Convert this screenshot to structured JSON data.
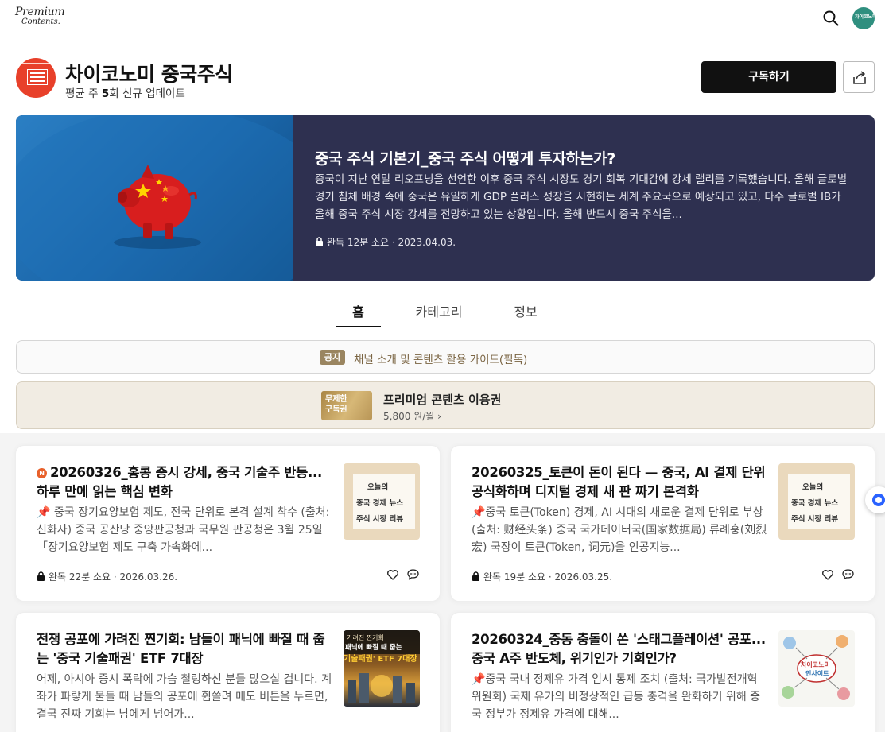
{
  "header": {
    "logo_line1": "Premium",
    "logo_line2": "Contents.",
    "search_icon": "search-icon",
    "avatar_text": "차이코노미"
  },
  "channel": {
    "title": "차이코노미 중국주식",
    "subtitle_prefix": "평균 주 ",
    "subtitle_count": "5",
    "subtitle_suffix": "회 신규 업데이트",
    "subscribe_label": "구독하기",
    "share_icon": "share-icon"
  },
  "hero": {
    "title": "중국 주식 기본기_중국 주식 어떻게 투자하는가?",
    "description": "중국이 지난 연말 리오프닝을 선언한 이후 중국 주식 시장도 경기 회복 기대감에 강세 랠리를 기록했습니다. 올해 글로벌 경기 침체 배경 속에 중국은 유일하게 GDP 플러스 성장을 시현하는 세계 주요국으로 예상되고 있고, 다수 글로벌 IB가 올해 중국 주식 시장 강세를 전망하고 있는 상황입니다. 올해 반드시 중국 주식을...",
    "meta": "완독 12분 소요 · 2023.04.03."
  },
  "tabs": [
    {
      "label": "홈",
      "active": true
    },
    {
      "label": "카테고리",
      "active": false
    },
    {
      "label": "정보",
      "active": false
    }
  ],
  "notice": {
    "badge": "공지",
    "text": "채널 소개 및 콘텐츠 활용 가이드(필독)"
  },
  "pass": {
    "card_label": "무제한 구독권",
    "name": "프리미엄 콘텐츠 이용권",
    "price": "5,800 원/월 ›"
  },
  "posts": [
    {
      "is_new": true,
      "new_badge": "N",
      "title": "20260326_홍콩 증시 강세, 중국 기술주 반등... 하루 만에 읽는 핵심 변화",
      "description": "📌 중국 장기요양보험 제도, 전국 단위로 본격 설계 착수 (출처: 신화사) 중국 공산당 중앙판공청과 국무원 판공청은 3월 25일「장기요양보험 제도 구축 가속화에...",
      "meta": "완독 22분 소요 · 2026.03.26.",
      "thumb_line1": "오늘의",
      "thumb_line2": "중국 경제 뉴스",
      "thumb_line3": "주식 시장 리뷰"
    },
    {
      "is_new": false,
      "title": "20260325_토큰이 돈이 된다 — 중국, AI 결제 단위 공식화하며 디지털 경제 새 판 짜기 본격화",
      "description": "📌중국 토큰(Token) 경제, AI 시대의 새로운 결제 단위로 부상 (출처: 财经头条) 중국 국가데이터국(国家数据局) 류례훙(刘烈宏) 국장이 토큰(Token, 词元)을 인공지능...",
      "meta": "완독 19분 소요 · 2026.03.25.",
      "thumb_line1": "오늘의",
      "thumb_line2": "중국 경제 뉴스",
      "thumb_line3": "주식 시장 리뷰"
    },
    {
      "is_new": false,
      "title": "전쟁 공포에 가려진 찐기회: 남들이 패닉에 빠질 때 줍는 '중국 기술패권' ETF 7대장",
      "description": "어제, 아시아 증시 폭락에 가슴 철렁하신 분들 많으실 겁니다. 계좌가 파랗게 물들 때 남들의 공포에 휩쓸려 매도 버튼을 누르면, 결국 진짜 기회는 남에게 넘어가...",
      "thumb_line1": "가려진 찐기회",
      "thumb_line2": "패닉에 빠질 때 줍는",
      "thumb_line3": "기술패권' ETF 7대장"
    },
    {
      "is_new": false,
      "title": "20260324_중동 충돌이 쏜 '스태그플레이션' 공포... 중국 A주 반도체, 위기인가 기회인가?",
      "description": "📌중국 국내 정제유 가격 임시 통제 조치 (출처: 국가발전개혁위원회) 국제 유가의 비정상적인 급등 충격을 완화하기 위해 중국 정부가 정제유 가격에 대해...",
      "thumb_line1": "차이코노미",
      "thumb_line2": "인사이트"
    }
  ],
  "colors": {
    "hero_bg": "#2e3050",
    "accent_gold": "#9a8560",
    "subscribe_bg": "#111111"
  }
}
